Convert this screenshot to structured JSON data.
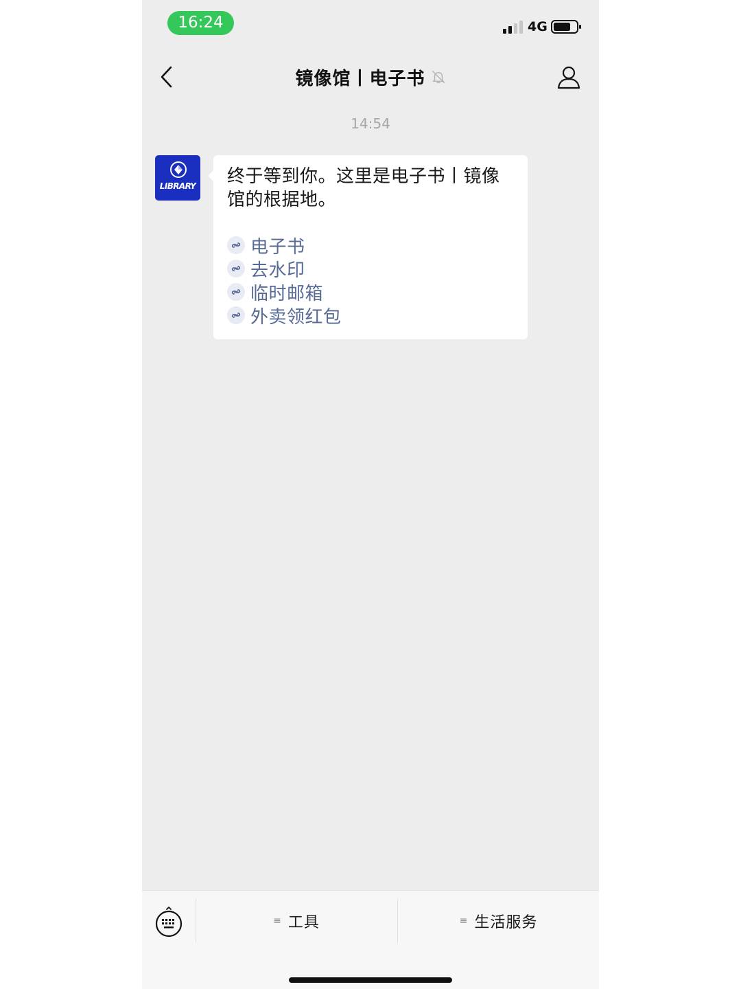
{
  "status_bar": {
    "time": "16:24",
    "network": "4G"
  },
  "nav": {
    "title": "镜像馆丨电子书"
  },
  "chat": {
    "timestamp": "14:54",
    "avatar_text": "LIBRARY",
    "message_text": "终于等到你。这里是电子书丨镜像馆的根据地。",
    "links": [
      {
        "label": "电子书"
      },
      {
        "label": "去水印"
      },
      {
        "label": "临时邮箱"
      },
      {
        "label": "外卖领红包"
      }
    ]
  },
  "menu": {
    "tools_label": "工具",
    "life_label": "生活服务"
  },
  "colors": {
    "time_pill": "#34c759",
    "link": "#576b95",
    "avatar_bg": "#1a2fbf",
    "background": "#ededed"
  },
  "icons": {
    "back": "chevron-left-icon",
    "mute": "bell-off-icon",
    "profile": "person-icon",
    "link": "mini-program-link-icon",
    "keyboard": "keyboard-icon",
    "menu": "menu-lines-icon"
  }
}
